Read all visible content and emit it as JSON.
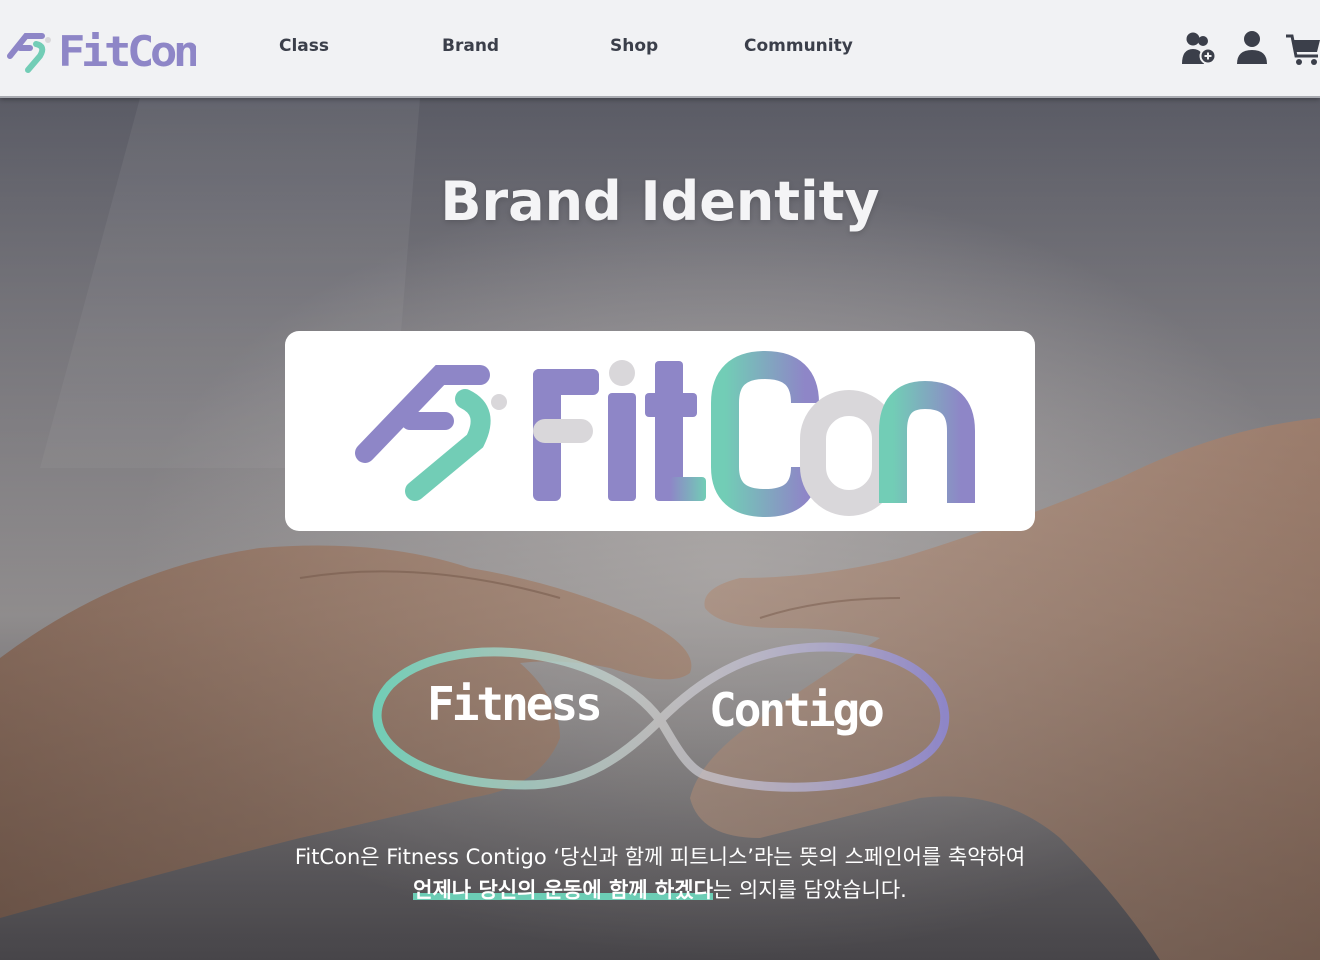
{
  "header": {
    "logo_text": "FitCon",
    "nav": [
      "Class",
      "Brand",
      "Shop",
      "Community"
    ],
    "icons": [
      "add-user-icon",
      "user-icon",
      "cart-icon"
    ]
  },
  "hero": {
    "title": "Brand Identity",
    "logo_text": "FitCon",
    "tagline_left": "Fitness",
    "tagline_right": "Contigo",
    "desc_line1": "FitCon은 Fitness Contigo ‘당신과 함께 피트니스’라는 뜻의 스페인어를 축약하여",
    "desc_line2_highlight": "언제나 당신의 운동에 함께 하겠다",
    "desc_line2_rest": "는 의지를 담았습니다."
  },
  "colors": {
    "purple": "#8e86c7",
    "mint": "#72cdb6",
    "gray": "#d9d7da",
    "header_bg": "#f1f2f4",
    "nav_text": "#3b3f4a"
  }
}
